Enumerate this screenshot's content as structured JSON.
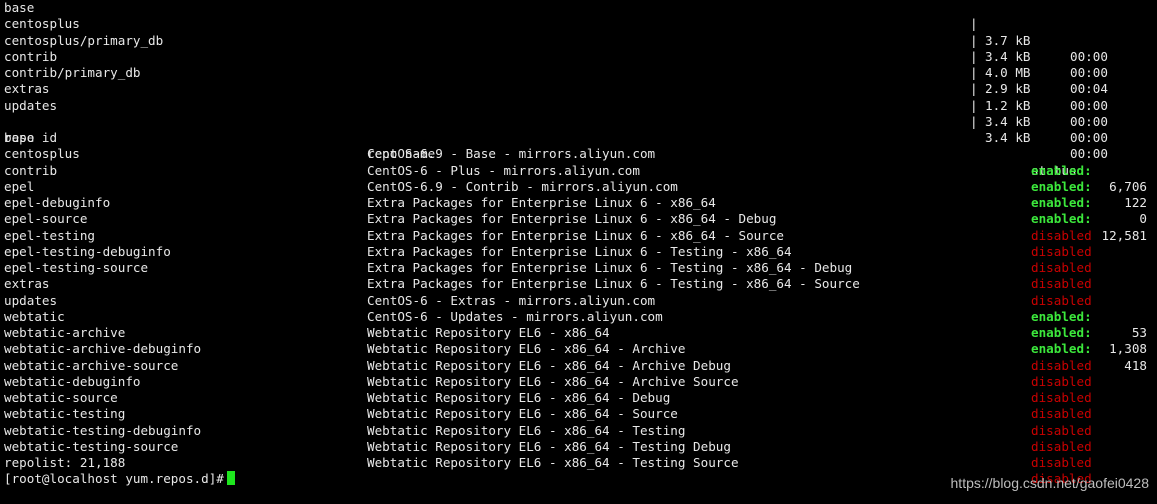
{
  "downloads": [
    {
      "name": "base",
      "size": "3.7 kB",
      "time": "00:00"
    },
    {
      "name": "centosplus",
      "size": "3.4 kB",
      "time": "00:00"
    },
    {
      "name": "centosplus/primary_db",
      "size": "4.0 MB",
      "time": "00:04"
    },
    {
      "name": "contrib",
      "size": "2.9 kB",
      "time": "00:00"
    },
    {
      "name": "contrib/primary_db",
      "size": "1.2 kB",
      "time": "00:00"
    },
    {
      "name": "extras",
      "size": "3.4 kB",
      "time": "00:00"
    },
    {
      "name": "updates",
      "size": "3.4 kB",
      "time": "00:00"
    }
  ],
  "headers": {
    "repo_id": "repo id",
    "repo_name": "repo name",
    "status": "status"
  },
  "repos": [
    {
      "id": "base",
      "name": "CentOS-6.9 - Base - mirrors.aliyun.com",
      "status": "enabled:",
      "count": "6,706",
      "enabled": true
    },
    {
      "id": "centosplus",
      "name": "CentOS-6 - Plus - mirrors.aliyun.com",
      "status": "enabled:",
      "count": "122",
      "enabled": true
    },
    {
      "id": "contrib",
      "name": "CentOS-6.9 - Contrib - mirrors.aliyun.com",
      "status": "enabled:",
      "count": "0",
      "enabled": true
    },
    {
      "id": "epel",
      "name": "Extra Packages for Enterprise Linux 6 - x86_64",
      "status": "enabled:",
      "count": "12,581",
      "enabled": true
    },
    {
      "id": "epel-debuginfo",
      "name": "Extra Packages for Enterprise Linux 6 - x86_64 - Debug",
      "status": "disabled",
      "count": "",
      "enabled": false
    },
    {
      "id": "epel-source",
      "name": "Extra Packages for Enterprise Linux 6 - x86_64 - Source",
      "status": "disabled",
      "count": "",
      "enabled": false
    },
    {
      "id": "epel-testing",
      "name": "Extra Packages for Enterprise Linux 6 - Testing - x86_64",
      "status": "disabled",
      "count": "",
      "enabled": false
    },
    {
      "id": "epel-testing-debuginfo",
      "name": "Extra Packages for Enterprise Linux 6 - Testing - x86_64 - Debug",
      "status": "disabled",
      "count": "",
      "enabled": false
    },
    {
      "id": "epel-testing-source",
      "name": "Extra Packages for Enterprise Linux 6 - Testing - x86_64 - Source",
      "status": "disabled",
      "count": "",
      "enabled": false
    },
    {
      "id": "extras",
      "name": "CentOS-6 - Extras - mirrors.aliyun.com",
      "status": "enabled:",
      "count": "53",
      "enabled": true
    },
    {
      "id": "updates",
      "name": "CentOS-6 - Updates - mirrors.aliyun.com",
      "status": "enabled:",
      "count": "1,308",
      "enabled": true
    },
    {
      "id": "webtatic",
      "name": "Webtatic Repository EL6 - x86_64",
      "status": "enabled:",
      "count": "418",
      "enabled": true
    },
    {
      "id": "webtatic-archive",
      "name": "Webtatic Repository EL6 - x86_64 - Archive",
      "status": "disabled",
      "count": "",
      "enabled": false
    },
    {
      "id": "webtatic-archive-debuginfo",
      "name": "Webtatic Repository EL6 - x86_64 - Archive Debug",
      "status": "disabled",
      "count": "",
      "enabled": false
    },
    {
      "id": "webtatic-archive-source",
      "name": "Webtatic Repository EL6 - x86_64 - Archive Source",
      "status": "disabled",
      "count": "",
      "enabled": false
    },
    {
      "id": "webtatic-debuginfo",
      "name": "Webtatic Repository EL6 - x86_64 - Debug",
      "status": "disabled",
      "count": "",
      "enabled": false
    },
    {
      "id": "webtatic-source",
      "name": "Webtatic Repository EL6 - x86_64 - Source",
      "status": "disabled",
      "count": "",
      "enabled": false
    },
    {
      "id": "webtatic-testing",
      "name": "Webtatic Repository EL6 - x86_64 - Testing",
      "status": "disabled",
      "count": "",
      "enabled": false
    },
    {
      "id": "webtatic-testing-debuginfo",
      "name": "Webtatic Repository EL6 - x86_64 - Testing Debug",
      "status": "disabled",
      "count": "",
      "enabled": false
    },
    {
      "id": "webtatic-testing-source",
      "name": "Webtatic Repository EL6 - x86_64 - Testing Source",
      "status": "disabled",
      "count": "",
      "enabled": false
    }
  ],
  "repolist": "repolist: 21,188",
  "prompt": "[root@localhost yum.repos.d]#",
  "watermark": "https://blog.csdn.net/gaofei0428",
  "colors": {
    "enabled": "#3ce83c",
    "disabled": "#c80000",
    "cursor": "#1ee61e",
    "background": "#000000",
    "text": "#e8e8e8"
  }
}
